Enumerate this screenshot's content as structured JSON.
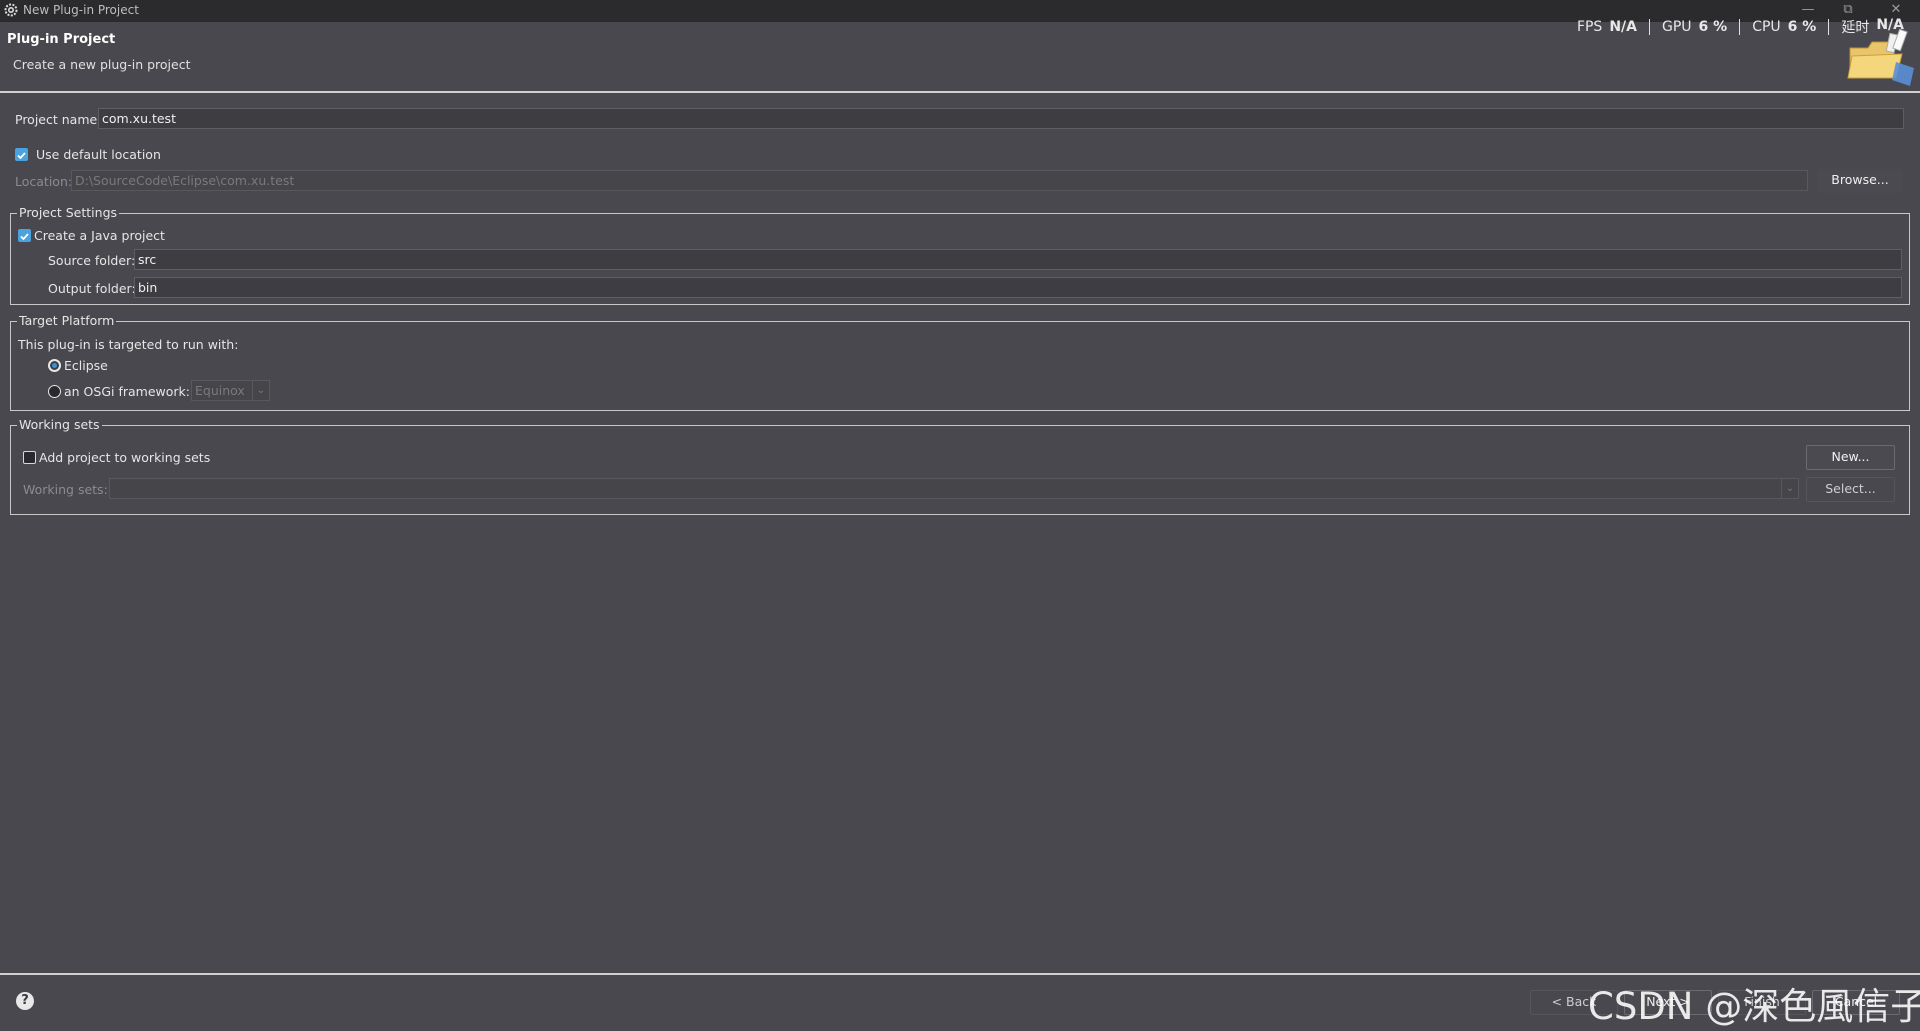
{
  "window": {
    "title": "New Plug-in Project",
    "controls": [
      "—",
      "⧉",
      "✕"
    ]
  },
  "overlay": {
    "items": [
      {
        "label": "FPS",
        "value": "N/A"
      },
      {
        "label": "GPU",
        "value": "6 %"
      },
      {
        "label": "CPU",
        "value": "6 %"
      },
      {
        "label": "延时",
        "value": "N/A"
      }
    ]
  },
  "header": {
    "title": "Plug-in Project",
    "description": "Create a new plug-in project"
  },
  "project": {
    "name_label": "Project name:",
    "name_value": "com.xu.test",
    "use_default_location": "Use default location",
    "use_default_checked": true,
    "location_label": "Location:",
    "location_value": "D:\\SourceCode\\Eclipse\\com.xu.test",
    "browse_label": "Browse..."
  },
  "project_settings": {
    "group_title": "Project Settings",
    "create_java": "Create a Java project",
    "create_java_checked": true,
    "source_label": "Source folder:",
    "source_value": "src",
    "output_label": "Output folder:",
    "output_value": "bin"
  },
  "target_platform": {
    "group_title": "Target Platform",
    "intro": "This plug-in is targeted to run with:",
    "eclipse_label": "Eclipse",
    "osgi_label": "an OSGi framework:",
    "osgi_value": "Equinox",
    "selected": "Eclipse"
  },
  "working_sets": {
    "group_title": "Working sets",
    "add_label": "Add project to working sets",
    "add_checked": false,
    "new_label": "New...",
    "sets_label": "Working sets:",
    "sets_value": "",
    "select_label": "Select..."
  },
  "footer": {
    "help": "?",
    "back_label": "< Back",
    "next_label": "Next >",
    "finish_label": "Finish",
    "cancel_label": "Cancel",
    "watermark": "CSDN @深色風信子"
  },
  "colors": {
    "background": "#48484e",
    "accent": "#4aa3df",
    "titlebar": "#2b2b2e"
  }
}
